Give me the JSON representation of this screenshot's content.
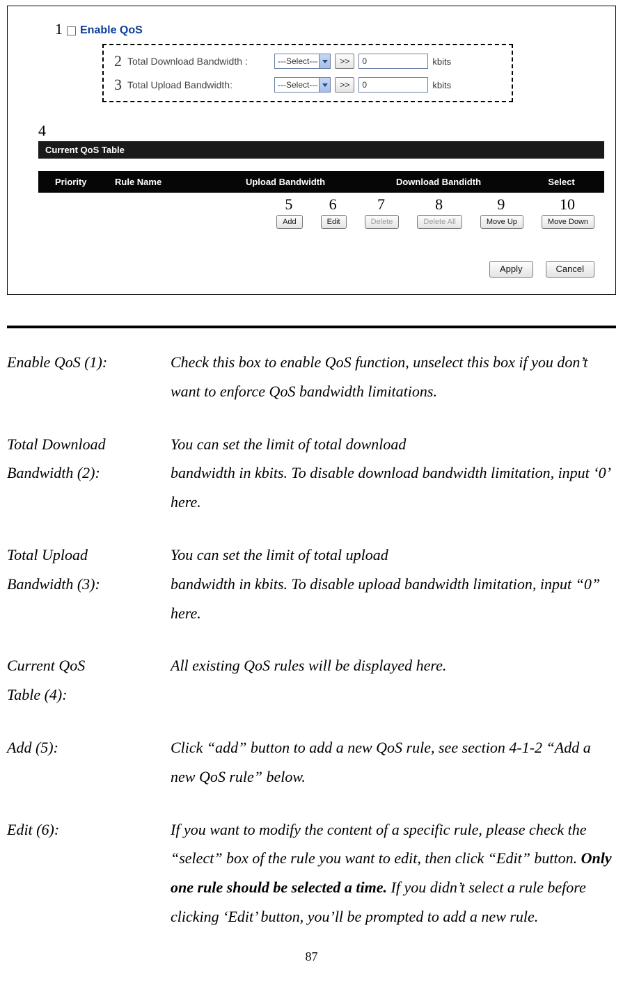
{
  "screenshot": {
    "enable": {
      "annot": "1",
      "label": "Enable QoS"
    },
    "download": {
      "annot": "2",
      "label": "Total Download Bandwidth :",
      "select": "---Select---",
      "go": ">>",
      "value": "0",
      "unit": "kbits"
    },
    "upload": {
      "annot": "3",
      "label": "Total Upload Bandwidth:",
      "select": "---Select---",
      "go": ">>",
      "value": "0",
      "unit": "kbits"
    },
    "section4_annot": "4",
    "qos_table_title": "Current QoS Table",
    "columns": {
      "priority": "Priority",
      "rule": "Rule Name",
      "upload": "Upload Bandwidth",
      "download": "Download Bandidth",
      "select": "Select"
    },
    "buttons": {
      "add": {
        "annot": "5",
        "label": "Add"
      },
      "edit": {
        "annot": "6",
        "label": "Edit"
      },
      "delete": {
        "annot": "7",
        "label": "Delete"
      },
      "delall": {
        "annot": "8",
        "label": "Delete All"
      },
      "moveup": {
        "annot": "9",
        "label": "Move Up"
      },
      "movedown": {
        "annot": "10",
        "label": "Move Down"
      }
    },
    "apply": "Apply",
    "cancel": "Cancel"
  },
  "defs": {
    "r1": {
      "term": "Enable QoS (1):",
      "def": "Check this box to enable QoS function, unselect this box if you don’t want to enforce QoS bandwidth limitations."
    },
    "r2": {
      "term1": "Total Download",
      "term2": "Bandwidth (2):",
      "def1": "You can set the limit of total download",
      "def2": "bandwidth in kbits. To disable download bandwidth limitation, input ‘0’ here."
    },
    "r3": {
      "term1": "Total Upload",
      "term2": "Bandwidth (3):",
      "def1": "You can set the limit of total upload",
      "def2": "bandwidth in kbits. To disable upload bandwidth limitation, input “0” here."
    },
    "r4": {
      "term1": "Current QoS",
      "term2": "Table (4):",
      "def": "All existing QoS rules will be displayed here."
    },
    "r5": {
      "term": "Add (5):",
      "def": "Click “add” button to add a new QoS rule, see section 4-1-2 “Add a new QoS rule” below."
    },
    "r6": {
      "term": "Edit (6):",
      "def_a": "If you want to modify the content of a specific rule, please check the “select” box of the rule you want to edit, then click “Edit” button. ",
      "def_bold": "Only one rule should be selected a time.",
      "def_b": " If you didn’t select a rule before clicking ‘Edit’ button, you’ll be prompted to add a new rule."
    }
  },
  "page_number": "87"
}
